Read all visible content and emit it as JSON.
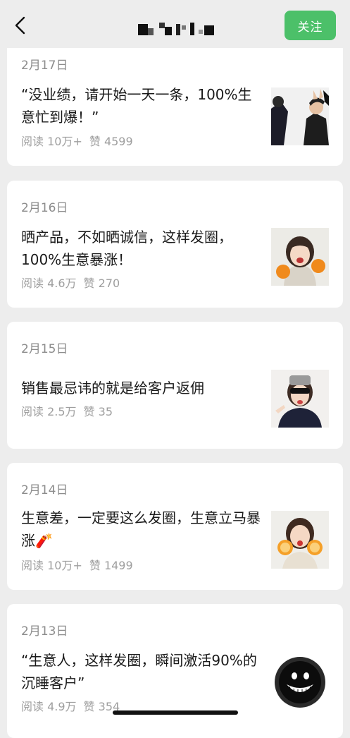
{
  "header": {
    "follow_label": "关注"
  },
  "articles": [
    {
      "date": "2月17日",
      "title": "“没业绩，请开始一天一条，100%生意忙到爆！”",
      "reads": "阅读 10万+",
      "likes": "赞 4599",
      "thumb": "two-figures-dark"
    },
    {
      "date": "2月16日",
      "title": "晒产品，不如晒诚信，这样发圈，100%生意暴涨！",
      "reads": "阅读 4.6万",
      "likes": "赞 270",
      "thumb": "girl-with-oranges"
    },
    {
      "date": "2月15日",
      "title": "销售最忌讳的就是给客户返佣",
      "reads": "阅读 2.5万",
      "likes": "赞 35",
      "thumb": "girl-with-sunglasses"
    },
    {
      "date": "2月14日",
      "title": "生意差，一定要这么发圈，生意立马暴涨🧨",
      "reads": "阅读 10万+",
      "likes": "赞 1499",
      "thumb": "girl-with-orange-slices"
    },
    {
      "date": "2月13日",
      "title": "“生意人，这样发圈，瞬间激活90%的沉睡客户”",
      "reads": "阅读 4.9万",
      "likes": "赞 354",
      "thumb": "grinning-dark-creature"
    }
  ]
}
